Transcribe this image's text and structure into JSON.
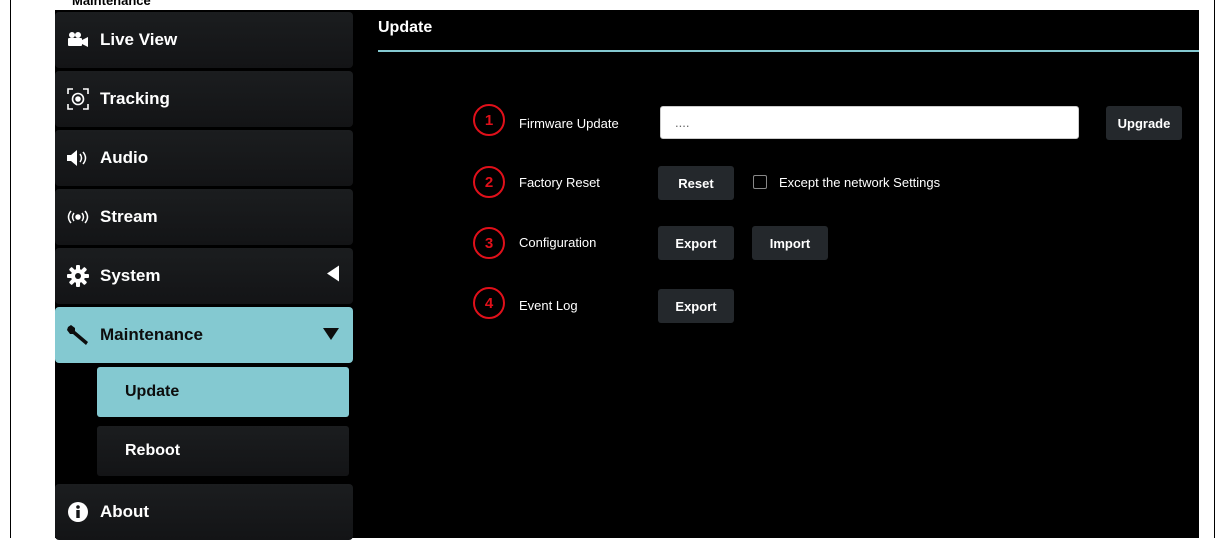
{
  "caption": "Maintenance",
  "sidebar": {
    "items": [
      {
        "label": "Live View",
        "icon": "video-camera-icon"
      },
      {
        "label": "Tracking",
        "icon": "tracking-target-icon"
      },
      {
        "label": "Audio",
        "icon": "speaker-icon"
      },
      {
        "label": "Stream",
        "icon": "broadcast-icon"
      },
      {
        "label": "System",
        "icon": "gear-icon",
        "arrow": "collapsed"
      },
      {
        "label": "Maintenance",
        "icon": "wrench-icon",
        "arrow": "expanded",
        "active": true
      },
      {
        "label": "About",
        "icon": "info-icon"
      }
    ],
    "subitems": [
      {
        "label": "Update",
        "active": true
      },
      {
        "label": "Reboot"
      }
    ]
  },
  "main": {
    "title": "Update",
    "rows": [
      {
        "num": "1",
        "label": "Firmware Update"
      },
      {
        "num": "2",
        "label": "Factory Reset"
      },
      {
        "num": "3",
        "label": "Configuration"
      },
      {
        "num": "4",
        "label": "Event Log"
      }
    ],
    "firmware_value": "....",
    "upgrade_label": "Upgrade",
    "reset_label": "Reset",
    "except_network_label": "Except the network Settings",
    "except_network_checked": false,
    "config_export_label": "Export",
    "config_import_label": "Import",
    "eventlog_export_label": "Export"
  },
  "colors": {
    "accent": "#84c9d1",
    "annotation": "#e0101a",
    "background": "#000000"
  }
}
